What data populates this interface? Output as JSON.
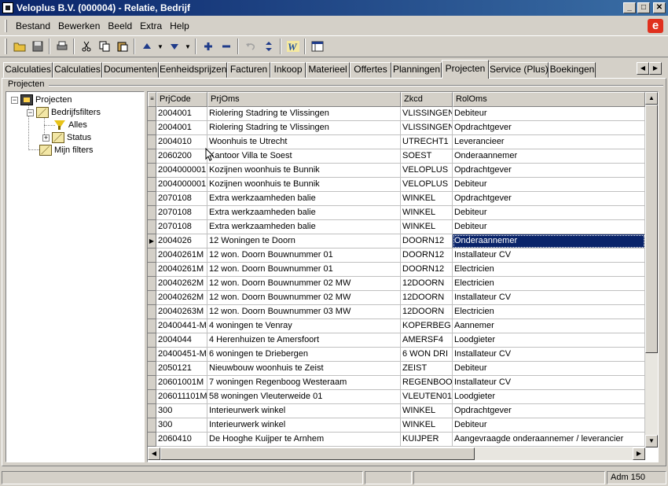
{
  "window": {
    "title": "Veloplus B.V. (000004) - Relatie, Bedrijf",
    "min": "_",
    "max": "□",
    "close": "✕"
  },
  "brand_logo": "e",
  "menu": [
    {
      "label": "Bestand"
    },
    {
      "label": "Bewerken"
    },
    {
      "label": "Beeld"
    },
    {
      "label": "Extra"
    },
    {
      "label": "Help"
    }
  ],
  "toolbar": {
    "icons": [
      "open-folder-icon",
      "save-icon",
      "print-icon",
      "cut-icon",
      "copy-icon",
      "paste-icon",
      "arrow-up-icon",
      "arrow-down-icon",
      "plus-icon",
      "minus-icon",
      "undo-icon",
      "refresh-icon",
      "w-icon",
      "window-icon"
    ]
  },
  "tabs": [
    {
      "label": "Calculaties"
    },
    {
      "label": "Calculaties"
    },
    {
      "label": "Documenten"
    },
    {
      "label": "Eenheidsprijzen"
    },
    {
      "label": "Facturen"
    },
    {
      "label": "Inkoop"
    },
    {
      "label": "Materieel"
    },
    {
      "label": "Offertes"
    },
    {
      "label": "Planningen"
    },
    {
      "label": "Projecten"
    },
    {
      "label": "Service (Plus)"
    },
    {
      "label": "Boekingen"
    }
  ],
  "active_tab": "Projecten",
  "group_label": "Projecten",
  "tree": {
    "root": "Projecten",
    "bedrijfsfilters": "Bedrijfsfilters",
    "alles": "Alles",
    "status": "Status",
    "mijn_filters": "Mijn filters"
  },
  "grid": {
    "columns": [
      "PrjCode",
      "PrjOms",
      "Zkcd",
      "RolOms"
    ],
    "selected_row": 9,
    "rows": [
      [
        "2004001",
        "Riolering Stadring te Vlissingen",
        "VLISSINGEN",
        "Debiteur"
      ],
      [
        "2004001",
        "Riolering Stadring te Vlissingen",
        "VLISSINGEN",
        "Opdrachtgever"
      ],
      [
        "2004010",
        "Woonhuis te Utrecht",
        "UTRECHT1",
        "Leverancieer"
      ],
      [
        "2060200",
        "Kantoor Villa te Soest",
        "SOEST",
        "Onderaannemer"
      ],
      [
        "2004000001",
        "Kozijnen woonhuis te Bunnik",
        "VELOPLUS",
        "Opdrachtgever"
      ],
      [
        "2004000001",
        "Kozijnen woonhuis te Bunnik",
        "VELOPLUS",
        "Debiteur"
      ],
      [
        "2070108",
        "Extra werkzaamheden balie",
        "WINKEL",
        "Opdrachtgever"
      ],
      [
        "2070108",
        "Extra werkzaamheden balie",
        "WINKEL",
        "Debiteur"
      ],
      [
        "2070108",
        "Extra werkzaamheden balie",
        "WINKEL",
        "Debiteur"
      ],
      [
        "2004026",
        "12 Woningen te Doorn",
        "DOORN12",
        "Onderaannemer"
      ],
      [
        "20040261M",
        "12 won. Doorn Bouwnummer 01",
        "DOORN12",
        "Installateur CV"
      ],
      [
        "20040261M",
        "12 won. Doorn Bouwnummer 01",
        "DOORN12",
        "Electricien"
      ],
      [
        "20040262M",
        "12 won. Doorn Bouwnummer 02 MW",
        "12DOORN",
        "Electricien"
      ],
      [
        "20040262M",
        "12 won. Doorn Bouwnummer 02 MW",
        "12DOORN",
        "Installateur CV"
      ],
      [
        "20040263M",
        "12 won. Doorn Bouwnummer 03 MW",
        "12DOORN",
        "Electricien"
      ],
      [
        "20400441-M",
        "4 woningen te Venray",
        "KOPERBEG",
        "Aannemer"
      ],
      [
        "2004044",
        "4 Herenhuizen te Amersfoort",
        "AMERSF4",
        "Loodgieter"
      ],
      [
        "20400451-M",
        "6 woningen te Driebergen",
        "6 WON DRI",
        "Installateur CV"
      ],
      [
        "2050121",
        "Nieuwbouw woonhuis te Zeist",
        "ZEIST",
        "Debiteur"
      ],
      [
        "20601001M",
        "7 woningen Regenboog Westeraam",
        "REGENBOOG",
        "Installateur CV"
      ],
      [
        "206011101M",
        "58 woningen Vleuterweide 01",
        "VLEUTEN01",
        "Loodgieter"
      ],
      [
        "300",
        "Interieurwerk winkel",
        "WINKEL",
        "Opdrachtgever"
      ],
      [
        "300",
        "Interieurwerk winkel",
        "WINKEL",
        "Debiteur"
      ],
      [
        "2060410",
        "De Hooghe Kuijper te Arnhem",
        "KUIJPER",
        "Aangevraagde onderaannemer / leverancier"
      ]
    ]
  },
  "status": {
    "user": "Adm 150"
  }
}
